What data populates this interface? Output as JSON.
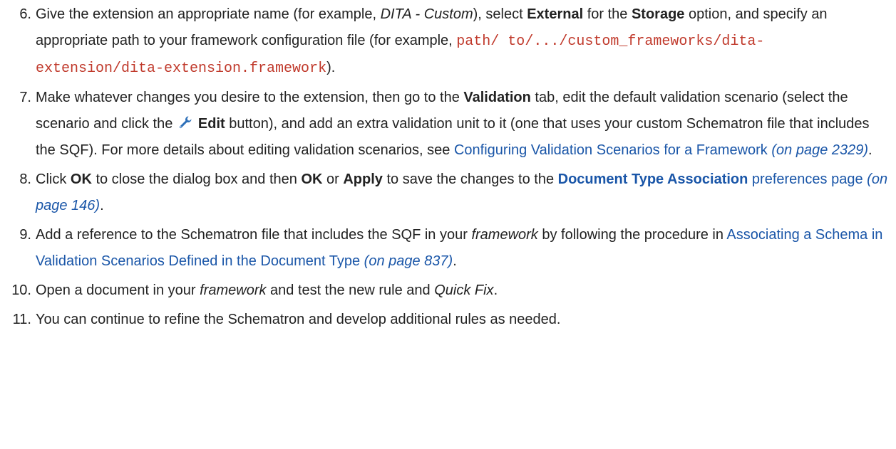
{
  "steps": [
    {
      "num": "6.",
      "t1": "Give the extension an appropriate name (for example, ",
      "t2": "DITA - Custom",
      "t3": "), select ",
      "t4": "External",
      "t5": " for the ",
      "t6": "Storage",
      "t7": " option, and specify an appropriate path to your framework configuration file (for example, ",
      "t8": "path/ to/.../custom_frameworks/dita-extension/dita-extension.framework",
      "t9": ")."
    },
    {
      "num": "7.",
      "t1": "Make whatever changes you desire to the extension, then go to the ",
      "t2": "Validation",
      "t3": " tab, edit the default validation scenario (select the scenario and click the",
      "icon": "wrench-icon",
      "t4": "Edit",
      "t5": " button), and add an extra validation unit to it (one that uses your custom Schematron file that includes the SQF). For more details about editing validation scenarios, see ",
      "t6": "Configuring Validation Scenarios for a Framework",
      "t7": "(on page 2329)",
      "t8": "."
    },
    {
      "num": "8.",
      "t1": "Click ",
      "t2": "OK",
      "t3": " to close the dialog box and then ",
      "t4": "OK",
      "t5": " or ",
      "t6": "Apply",
      "t7": " to save the changes to the ",
      "t8": "Document Type Association",
      "t9": " preferences page",
      "t10": "(on page 146)",
      "t11": "."
    },
    {
      "num": "9.",
      "t1": "Add a reference to the Schematron file that includes the SQF in your ",
      "t2": "framework",
      "t3": " by following the procedure in ",
      "t4": "Associating a Schema in Validation Scenarios Defined in the Document Type",
      "t5": "(on page 837)",
      "t6": "."
    },
    {
      "num": "10.",
      "t1": "Open a document in your ",
      "t2": "framework",
      "t3": " and test the new rule and ",
      "t4": "Quick Fix",
      "t5": "."
    },
    {
      "num": "11.",
      "t1": "You can continue to refine the Schematron and develop additional rules as needed."
    }
  ],
  "colors": {
    "text": "#222222",
    "link": "#1a56a8",
    "code": "#c0392b",
    "wrench_blue": "#2d6fb8"
  }
}
